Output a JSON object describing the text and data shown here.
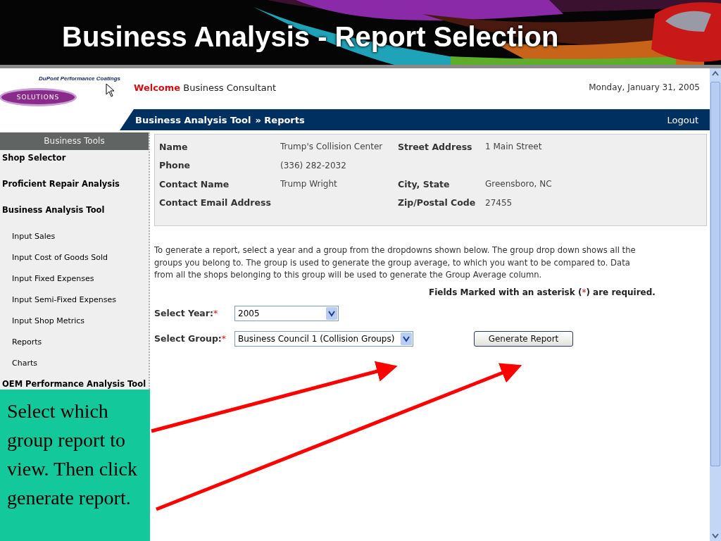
{
  "slide_title": "Business Analysis - Report Selection",
  "app": {
    "logo_text": "DuPont Performance Coatings",
    "logo_badge": "SOLUTIONS",
    "welcome": {
      "greeting": "Welcome",
      "user": "Business Consultant"
    },
    "date": "Monday, January 31, 2005",
    "breadcrumb": {
      "items": [
        "Business Analysis Tool",
        "Reports"
      ],
      "separator": "»"
    },
    "logout": "Logout",
    "sidebar": {
      "title": "Business Tools",
      "items": [
        {
          "label": "Shop Selector",
          "kind": "section"
        },
        {
          "label": "Proficient Repair Analysis",
          "kind": "section"
        },
        {
          "label": "Business Analysis Tool",
          "kind": "section"
        },
        {
          "label": "Input Sales",
          "kind": "sub"
        },
        {
          "label": "Input Cost of Goods Sold",
          "kind": "sub"
        },
        {
          "label": "Input Fixed Expenses",
          "kind": "sub"
        },
        {
          "label": "Input Semi-Fixed Expenses",
          "kind": "sub"
        },
        {
          "label": "Input Shop Metrics",
          "kind": "sub"
        },
        {
          "label": "Reports",
          "kind": "sub"
        },
        {
          "label": "Charts",
          "kind": "sub"
        },
        {
          "label": "OEM Performance Analysis Tool",
          "kind": "section"
        }
      ]
    },
    "shop_info": [
      {
        "label": "Name",
        "value": "Trump's Collision Center",
        "label_2": "Street Address",
        "value_2": "1 Main Street"
      },
      {
        "label": "Phone",
        "value": "(336) 282-2032"
      },
      {
        "label": "Contact Name",
        "value": "Trump Wright",
        "label_2": "City, State",
        "value_2": "Greensboro, NC"
      },
      {
        "label": "Contact Email Address",
        "label_2": "Zip/Postal Code",
        "value_2": "27455"
      }
    ],
    "instructions": "To generate a report, select a year and a group from the dropdowns shown below. The group drop down shows all the groups you belong to. The group is used to generate the group average, to which you want to be compared to. Data from all the shops belonging to this group will be used to generate the Group Average column.",
    "required_note": {
      "before": "Fields Marked with an asterisk (",
      "mark": "*",
      "after": ") are required."
    },
    "form": {
      "year": {
        "label": "Select Year:",
        "mark": "*",
        "value": "2005"
      },
      "group": {
        "label": "Select Group:",
        "mark": "*",
        "value": "Business Council 1 (Collision Groups)"
      },
      "button": "Generate Report"
    }
  },
  "callout": "Select which group report to view. Then click generate report."
}
